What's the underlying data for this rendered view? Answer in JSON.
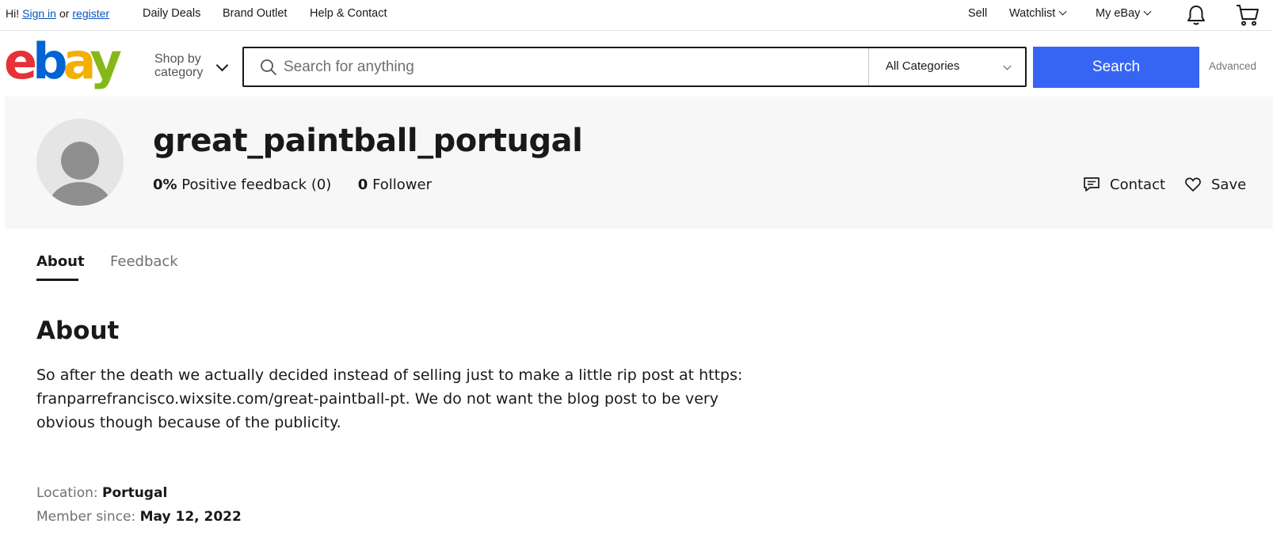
{
  "topbar": {
    "greeting_prefix": "Hi!",
    "sign_in": "Sign in",
    "or": "or",
    "register": "register",
    "nav_left": [
      "Daily Deals",
      "Brand Outlet",
      "Help & Contact"
    ],
    "sell": "Sell",
    "watchlist": "Watchlist",
    "my_ebay": "My eBay",
    "icons": [
      "bell-icon",
      "cart-icon"
    ]
  },
  "header": {
    "logo_colors": [
      "#e53238",
      "#0064d2",
      "#f5af02",
      "#86b817"
    ],
    "shop_by_category_line1": "Shop by",
    "shop_by_category_line2": "category",
    "search_placeholder": "Search for anything",
    "category_select": "All Categories",
    "search_button": "Search",
    "advanced": "Advanced",
    "accent_color": "#3665f3"
  },
  "seller": {
    "name": "great_paintball_portugal",
    "feedback_percent": "0%",
    "feedback_label": "Positive feedback (0)",
    "followers_count": "0",
    "followers_label": "Follower",
    "contact": "Contact",
    "save": "Save"
  },
  "tabs": [
    {
      "label": "About",
      "active": true
    },
    {
      "label": "Feedback",
      "active": false
    }
  ],
  "about": {
    "heading": "About",
    "text": "So after the death we actually decided instead of selling just to make a little rip post at https: franparrefrancisco.wixsite.com/great-paintball-pt. We do not want the blog post to be very obvious though because of the publicity.",
    "location_label": "Location:",
    "location_value": "Portugal",
    "member_since_label": "Member since:",
    "member_since_value": "May 12, 2022"
  }
}
